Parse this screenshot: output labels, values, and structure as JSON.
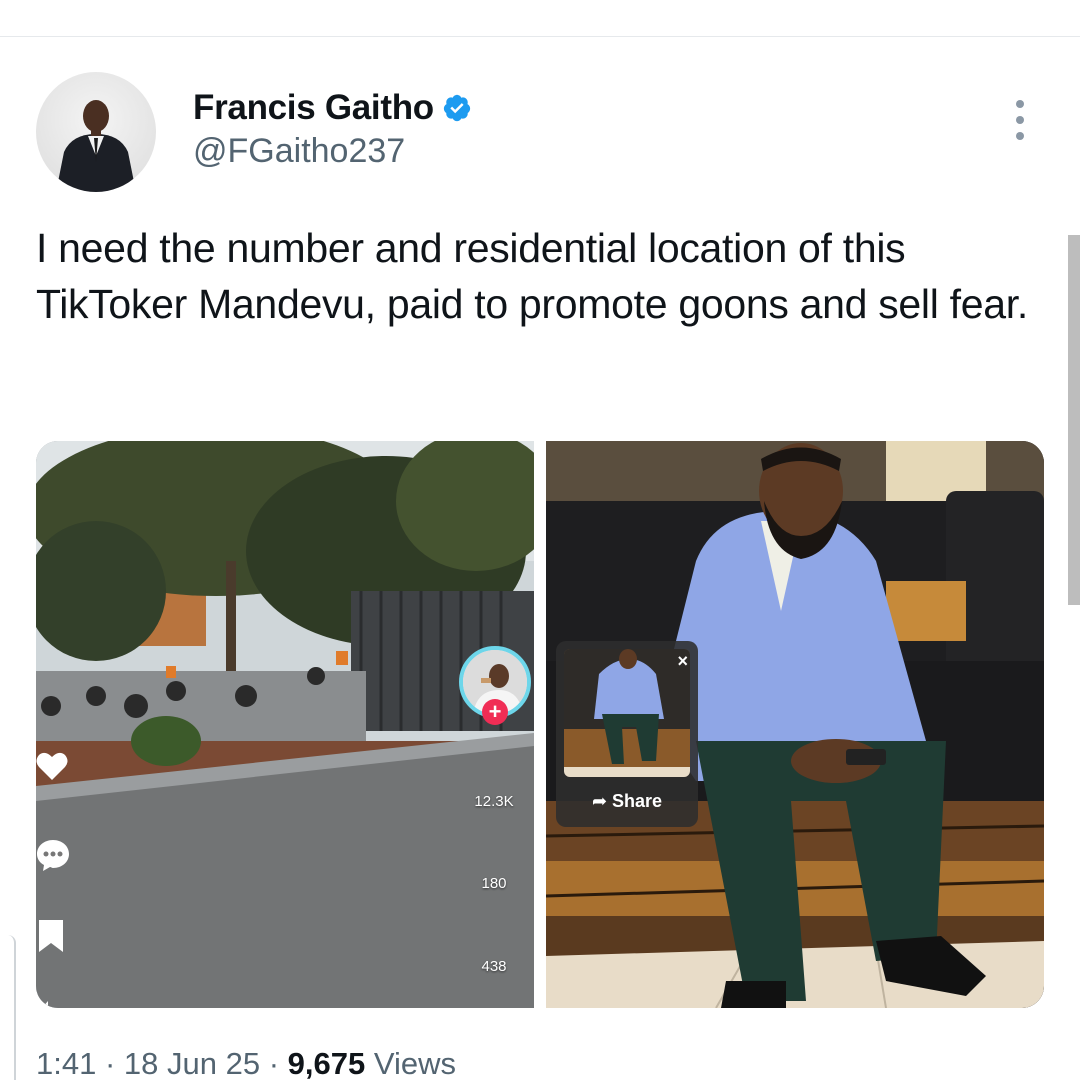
{
  "author": {
    "name": "Francis Gaitho",
    "handle": "@FGaitho237",
    "verified_icon": "verified-badge-icon",
    "accent": "#1d9bf0"
  },
  "tweet": {
    "text": "I need the number and residential location of this TikToker Mandevu, paid to promote goons and sell fear."
  },
  "media": {
    "left_video": {
      "likes": "12.3K",
      "comments": "180",
      "saves": "438"
    },
    "right_photo": {
      "share_label": "Share",
      "close_glyph": "×"
    }
  },
  "meta": {
    "time": "1:41",
    "sep1": " · ",
    "date": "18 Jun 25",
    "sep2": " · ",
    "views_count": "9,675",
    "views_label": " Views"
  }
}
